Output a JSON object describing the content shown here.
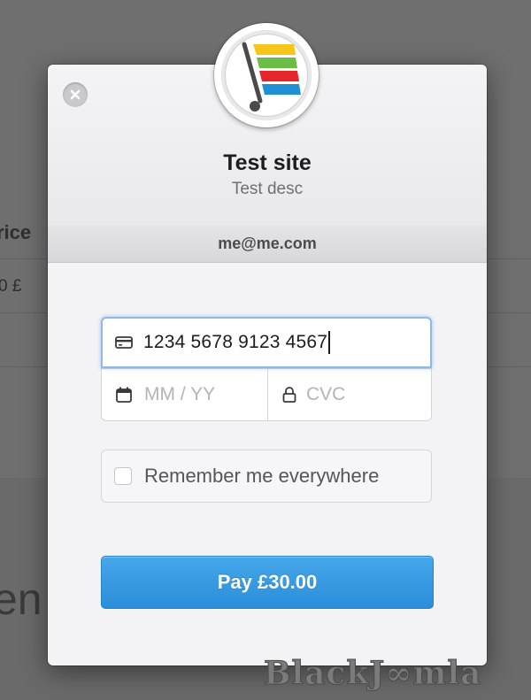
{
  "background": {
    "price_label": "rice",
    "price_value": "0 £",
    "big_text": "en"
  },
  "modal": {
    "close_icon": "close-icon",
    "logo_icon": "cart-logo-icon",
    "site_title": "Test site",
    "site_description": "Test desc",
    "email": "me@me.com",
    "card_number": {
      "value": "1234 5678 9123 4567",
      "icon": "credit-card-icon"
    },
    "expiry": {
      "placeholder": "MM / YY",
      "icon": "calendar-icon"
    },
    "cvc": {
      "placeholder": "CVC",
      "icon": "lock-icon"
    },
    "remember": {
      "label": "Remember me everywhere",
      "checked": false
    },
    "pay_button_label": "Pay £30.00",
    "accent_color": "#3a9be2"
  },
  "watermark": "BlackJ∞mla"
}
